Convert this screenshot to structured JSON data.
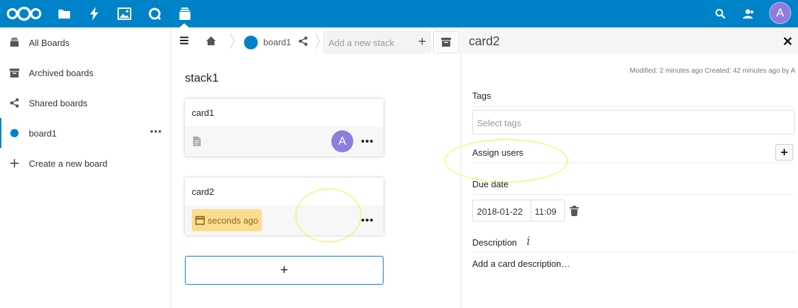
{
  "header": {
    "apps": [
      {
        "name": "nextcloud-logo",
        "active": false
      },
      {
        "name": "files-icon",
        "active": false
      },
      {
        "name": "activity-icon",
        "active": false
      },
      {
        "name": "gallery-icon",
        "active": false
      },
      {
        "name": "talk-icon",
        "active": false
      },
      {
        "name": "deck-icon",
        "active": true
      }
    ],
    "user_initial": "A",
    "brand_color": "#0082c9",
    "avatar_color": "#8e7cde"
  },
  "navigation": {
    "items": [
      {
        "label": "All Boards",
        "icon": "deck-icon"
      },
      {
        "label": "Archived boards",
        "icon": "archive-icon"
      },
      {
        "label": "Shared boards",
        "icon": "share-icon"
      },
      {
        "label": "board1",
        "icon": "board-color-dot",
        "active": true,
        "more": "•••"
      },
      {
        "label": "Create a new board",
        "icon": "plus-icon"
      }
    ]
  },
  "board": {
    "title": "board1",
    "new_stack_placeholder": "Add a new stack",
    "stack": {
      "title": "stack1",
      "cards": [
        {
          "title": "card1",
          "has_description": true,
          "assignee_initial": "A",
          "more": "•••"
        },
        {
          "title": "card2",
          "due": "seconds ago",
          "more": "•••"
        }
      ],
      "add_card": "+"
    }
  },
  "sidebar": {
    "title": "card2",
    "meta": "Modified: 2 minutes ago Created: 42 minutes ago by A",
    "tags_label": "Tags",
    "tags_placeholder": "Select tags",
    "assign_label": "Assign users",
    "assign_add": "+",
    "due_label": "Due date",
    "due_date": "2018-01-22",
    "due_time": "11:09",
    "description_label": "Description",
    "description_placeholder": "Add a card description…",
    "info_symbol": "i"
  },
  "colors": {
    "due_badge": "#fcdd8f",
    "highlight": "#f0ee3a"
  }
}
